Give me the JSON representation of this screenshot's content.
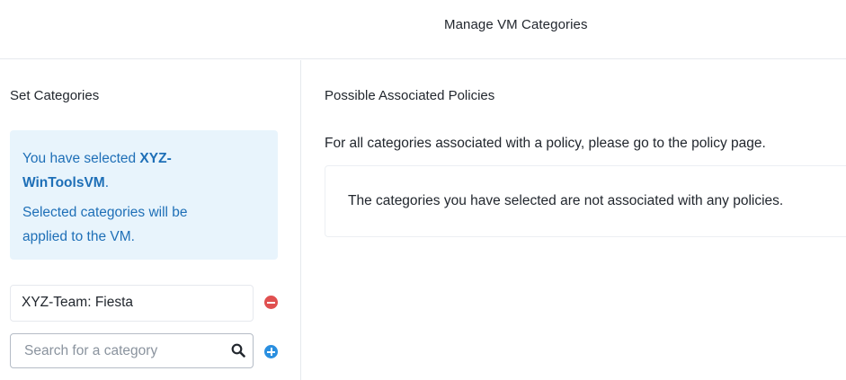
{
  "header": {
    "title": "Manage VM Categories"
  },
  "left": {
    "title": "Set Categories",
    "info": {
      "line1_prefix": "You have selected ",
      "line1_bold": "XYZ-",
      "line2_bold": "WinToolsVM",
      "line2_suffix": ".",
      "line3": "Selected categories will be",
      "line4": "applied to the VM."
    },
    "category": {
      "value": "XYZ-Team: Fiesta",
      "remove_icon": "minus-circle-icon"
    },
    "search": {
      "placeholder": "Search for a category",
      "icon": "search-icon",
      "add_icon": "plus-circle-icon"
    }
  },
  "right": {
    "title": "Possible Associated Policies",
    "note": "For all categories associated with a policy, please go to the policy page.",
    "empty_message": "The categories you have selected are not associated with any policies."
  },
  "colors": {
    "info_bg": "#e8f4fc",
    "info_text": "#1e6fb7",
    "remove": "#e05050",
    "add": "#2a8fe0",
    "border": "#e6e9ee"
  }
}
